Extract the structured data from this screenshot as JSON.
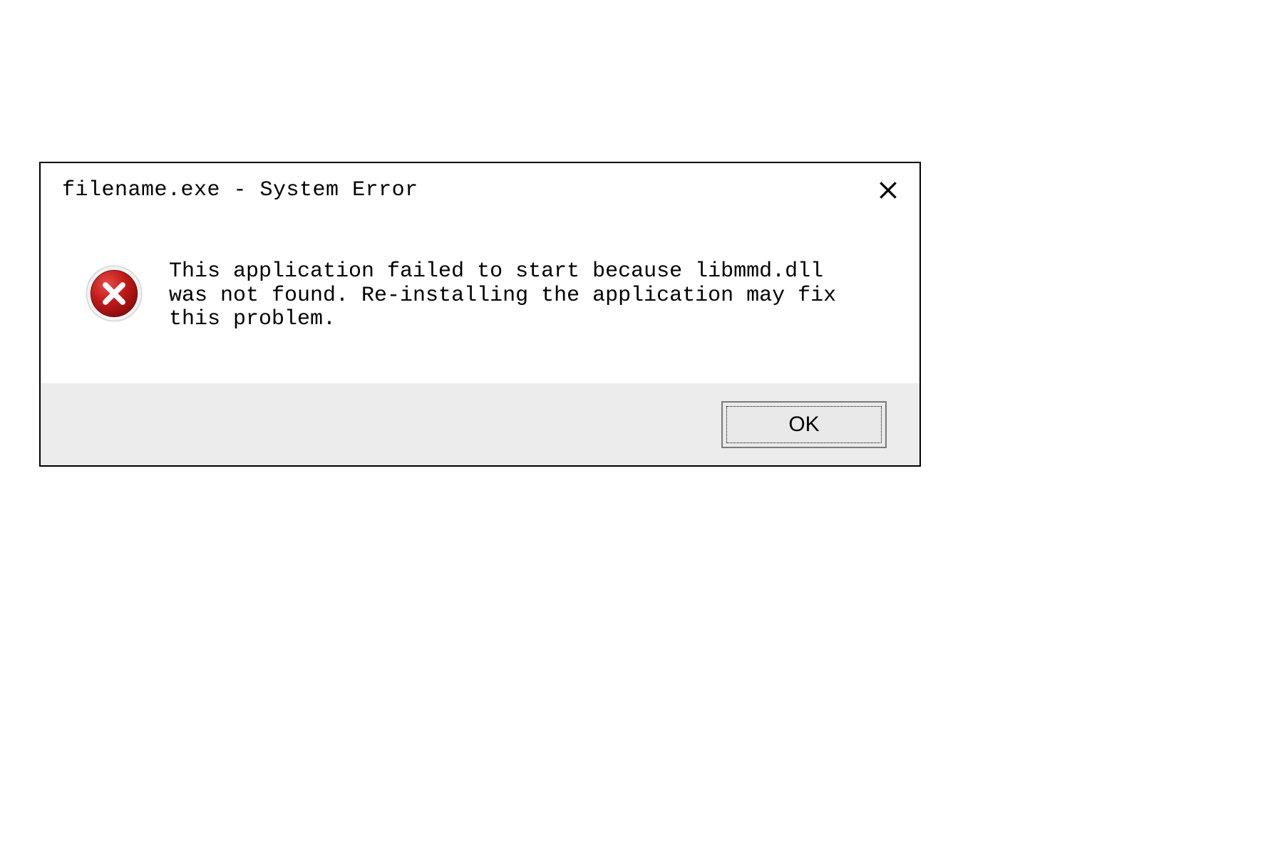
{
  "dialog": {
    "title": "filename.exe - System Error",
    "message": "This application failed to start because libmmd.dll was not found. Re-installing the application may fix this problem.",
    "ok_label": "OK",
    "icon": "error-x-icon",
    "colors": {
      "error_red": "#b81414",
      "error_red_light": "#d93030",
      "footer_bg": "#ececec",
      "button_bg": "#e9e9e9",
      "border": "#000000"
    }
  }
}
